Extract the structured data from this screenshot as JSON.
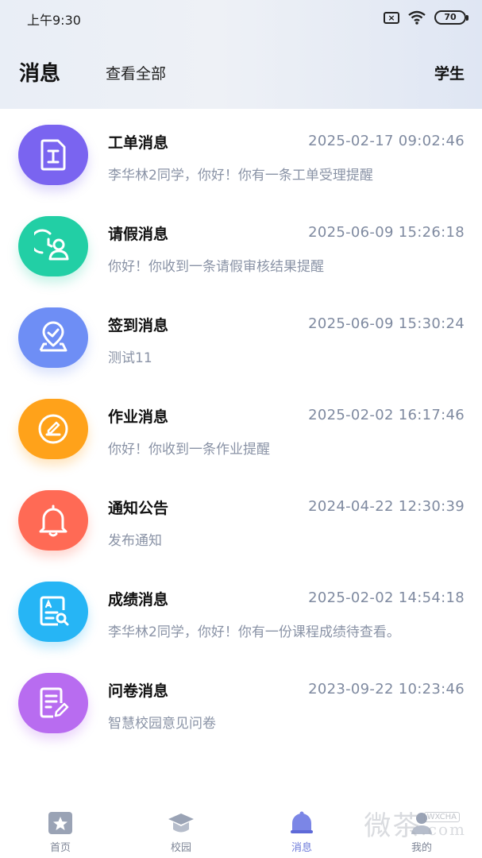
{
  "status_bar": {
    "time": "上午9:30",
    "battery": "70",
    "sim_icon": "sim-x-icon",
    "wifi_icon": "wifi-icon"
  },
  "header": {
    "title": "消息",
    "view_all": "查看全部",
    "role": "学生"
  },
  "messages": [
    {
      "title": "工单消息",
      "time": "2025-02-17 09:02:46",
      "desc": "李华林2同学，你好！你有一条工单受理提醒",
      "icon": "work-order-icon",
      "color": "#7a64f0"
    },
    {
      "title": "请假消息",
      "time": "2025-06-09 15:26:18",
      "desc": "你好！你收到一条请假审核结果提醒",
      "icon": "leave-user-clock-icon",
      "color": "#22cfa5"
    },
    {
      "title": "签到消息",
      "time": "2025-06-09 15:30:24",
      "desc": "测试11",
      "icon": "check-in-location-icon",
      "color": "#6e8ef5"
    },
    {
      "title": "作业消息",
      "time": "2025-02-02 16:17:46",
      "desc": "你好！你收到一条作业提醒",
      "icon": "homework-pen-icon",
      "color": "#ffa21a"
    },
    {
      "title": "通知公告",
      "time": "2024-04-22 12:30:39",
      "desc": "发布通知",
      "icon": "bell-icon",
      "color": "#ff6a55"
    },
    {
      "title": "成绩消息",
      "time": "2025-02-02 14:54:18",
      "desc": "李华林2同学，你好！你有一份课程成绩待查看。",
      "icon": "grade-search-icon",
      "color": "#26b5f5"
    },
    {
      "title": "问卷消息",
      "time": "2023-09-22 10:23:46",
      "desc": "智慧校园意见问卷",
      "icon": "questionnaire-icon",
      "color": "#b86cf0"
    }
  ],
  "tabbar": {
    "home": "首页",
    "campus": "校园",
    "messages": "消息",
    "mine": "我的"
  },
  "watermark": {
    "text": "微茶",
    "small": "WXCHA",
    "domain": ".com"
  }
}
